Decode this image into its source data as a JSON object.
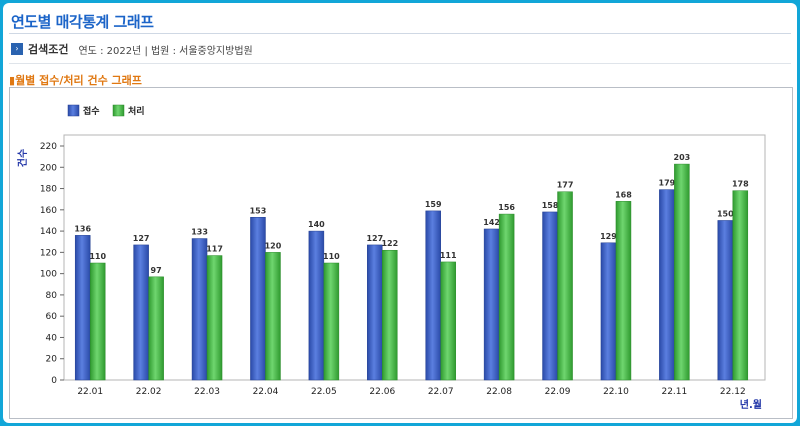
{
  "header": {
    "title": "연도별 매각통계 그래프"
  },
  "conditions": {
    "label": "검색조건",
    "value": "연도 : 2022년 | 법원 : 서울중앙지방법원"
  },
  "section": {
    "title": "월별 접수/처리 건수 그래프"
  },
  "colors": {
    "receive": "#3f63c4",
    "process": "#4dbb4d",
    "title": "#1b64c8",
    "section": "#e07812"
  },
  "chart_data": {
    "type": "bar",
    "categories": [
      "22.01",
      "22.02",
      "22.03",
      "22.04",
      "22.05",
      "22.06",
      "22.07",
      "22.08",
      "22.09",
      "22.10",
      "22.11",
      "22.12"
    ],
    "series": [
      {
        "name": "접수",
        "values": [
          136,
          127,
          133,
          153,
          140,
          127,
          159,
          142,
          158,
          129,
          179,
          150
        ]
      },
      {
        "name": "처리",
        "values": [
          110,
          97,
          117,
          120,
          110,
          122,
          111,
          156,
          177,
          168,
          203,
          178
        ]
      }
    ],
    "ylabel": "건수",
    "xlabel": "년.월",
    "ylim": [
      0,
      220
    ],
    "yticks": [
      0,
      20,
      40,
      60,
      80,
      100,
      120,
      140,
      160,
      180,
      200,
      220
    ],
    "legend": "top-left",
    "grid": false
  }
}
